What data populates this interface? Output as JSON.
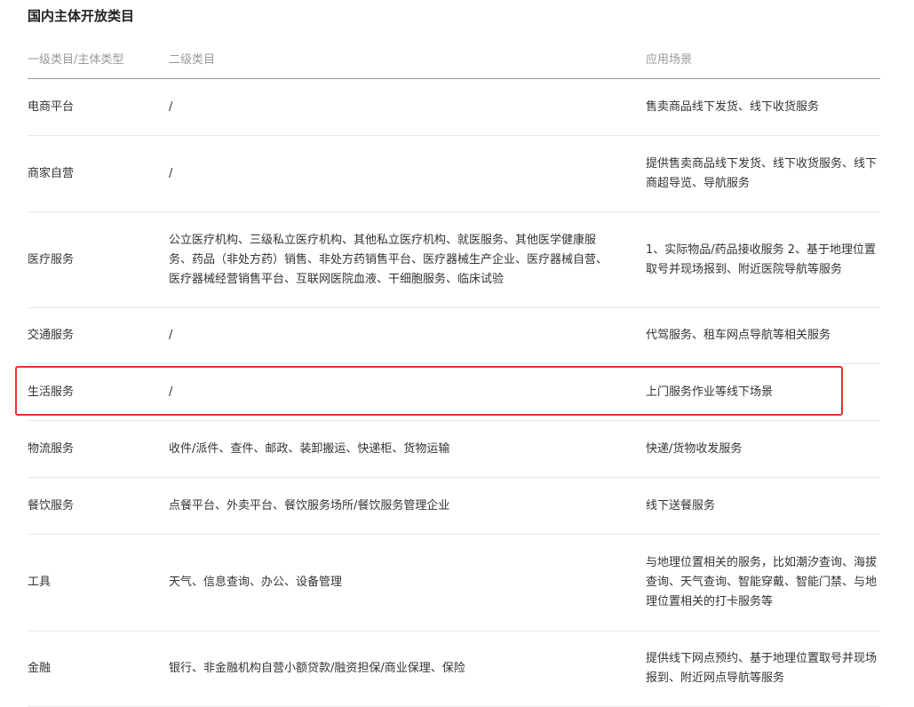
{
  "title": "国内主体开放类目",
  "headers": {
    "col1": "一级类目/主体类型",
    "col2": "二级类目",
    "col3": "应用场景"
  },
  "rows": [
    {
      "category": "电商平台",
      "subcategory": "/",
      "scenario": "售卖商品线下发货、线下收货服务"
    },
    {
      "category": "商家自营",
      "subcategory": "/",
      "scenario": "提供售卖商品线下发货、线下收货服务、线下商超导览、导航服务"
    },
    {
      "category": "医疗服务",
      "subcategory": "公立医疗机构、三级私立医疗机构、其他私立医疗机构、就医服务、其他医学健康服务、药品（非处方药）销售、非处方药销售平台、医疗器械生产企业、医疗器械自营、医疗器械经营销售平台、互联网医院血液、干细胞服务、临床试验",
      "scenario": "1、实际物品/药品接收服务 2、基于地理位置取号并现场报到、附近医院导航等服务"
    },
    {
      "category": "交通服务",
      "subcategory": "/",
      "scenario": "代驾服务、租车网点导航等相关服务"
    },
    {
      "category": "生活服务",
      "subcategory": "/",
      "scenario": "上门服务作业等线下场景"
    },
    {
      "category": "物流服务",
      "subcategory": "收件/派件、查件、邮政、装卸搬运、快递柜、货物运输",
      "scenario": "快递/货物收发服务"
    },
    {
      "category": "餐饮服务",
      "subcategory": "点餐平台、外卖平台、餐饮服务场所/餐饮服务管理企业",
      "scenario": "线下送餐服务"
    },
    {
      "category": "工具",
      "subcategory": "天气、信息查询、办公、设备管理",
      "scenario": "与地理位置相关的服务，比如潮汐查询、海拔查询、天气查询、智能穿戴、智能门禁、与地理位置相关的打卡服务等"
    },
    {
      "category": "金融",
      "subcategory": "银行、非金融机构自营小额贷款/融资担保/商业保理、保险",
      "scenario": "提供线下网点预约、基于地理位置取号并现场报到、附近网点导航等服务"
    }
  ],
  "annotation": {
    "highlight_color": "#e8302f",
    "highlighted_row": "生活服务"
  }
}
